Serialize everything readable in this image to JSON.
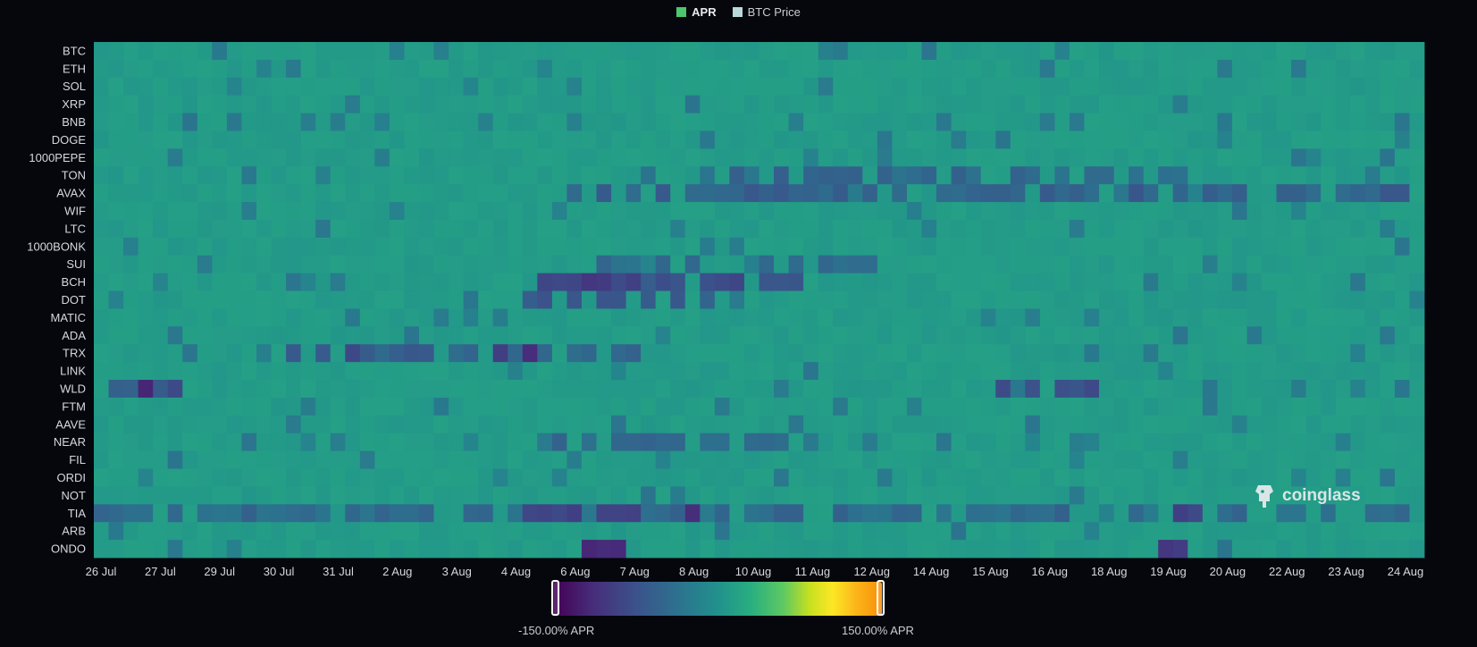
{
  "legend": {
    "apr_label": "APR",
    "btc_label": "BTC Price",
    "apr_color": "#4cc76c",
    "btc_color": "#b8d8da"
  },
  "watermark": {
    "text": "coinglass"
  },
  "scale": {
    "min_label": "-150.00% APR",
    "max_label": "150.00% APR"
  },
  "chart_data": {
    "type": "heatmap",
    "title": "",
    "xlabel": "",
    "ylabel": "",
    "value_range": [
      -150,
      150
    ],
    "value_unit": "% APR",
    "colormap": "viridis-orange",
    "grid": false,
    "y_categories": [
      "BTC",
      "ETH",
      "SOL",
      "XRP",
      "BNB",
      "DOGE",
      "1000PEPE",
      "TON",
      "AVAX",
      "WIF",
      "LTC",
      "1000BONK",
      "SUI",
      "BCH",
      "DOT",
      "MATIC",
      "ADA",
      "TRX",
      "LINK",
      "WLD",
      "FTM",
      "AAVE",
      "NEAR",
      "FIL",
      "ORDI",
      "NOT",
      "TIA",
      "ARB",
      "ONDO"
    ],
    "x_tick_labels": [
      "26 Jul",
      "27 Jul",
      "29 Jul",
      "30 Jul",
      "31 Jul",
      "2 Aug",
      "3 Aug",
      "4 Aug",
      "6 Aug",
      "7 Aug",
      "8 Aug",
      "10 Aug",
      "11 Aug",
      "12 Aug",
      "14 Aug",
      "15 Aug",
      "16 Aug",
      "18 Aug",
      "19 Aug",
      "20 Aug",
      "22 Aug",
      "23 Aug",
      "24 Aug"
    ],
    "x_count": 90,
    "baseline_apr": 10.95,
    "anomalies": [
      {
        "row": "TIA",
        "from": 0,
        "to": 89,
        "apr": -45
      },
      {
        "row": "TIA",
        "from": 29,
        "to": 37,
        "apr": -95
      },
      {
        "row": "TIA",
        "from": 40,
        "to": 41,
        "apr": -110
      },
      {
        "row": "TIA",
        "from": 70,
        "to": 74,
        "apr": -80
      },
      {
        "row": "WLD",
        "from": 0,
        "to": 5,
        "apr": -70
      },
      {
        "row": "WLD",
        "from": 3,
        "to": 3,
        "apr": -115
      },
      {
        "row": "WLD",
        "from": 61,
        "to": 67,
        "apr": -80
      },
      {
        "row": "TRX",
        "from": 13,
        "to": 37,
        "apr": -55
      },
      {
        "row": "TRX",
        "from": 16,
        "to": 17,
        "apr": -100
      },
      {
        "row": "TRX",
        "from": 27,
        "to": 29,
        "apr": -105
      },
      {
        "row": "BCH",
        "from": 30,
        "to": 48,
        "apr": -75
      },
      {
        "row": "BCH",
        "from": 32,
        "to": 36,
        "apr": -95
      },
      {
        "row": "AVAX",
        "from": 30,
        "to": 88,
        "apr": -55
      },
      {
        "row": "ONDO",
        "from": 33,
        "to": 36,
        "apr": -110
      },
      {
        "row": "ONDO",
        "from": 72,
        "to": 73,
        "apr": -105
      },
      {
        "row": "DOT",
        "from": 29,
        "to": 41,
        "apr": -60
      },
      {
        "row": "TON",
        "from": 38,
        "to": 75,
        "apr": -45
      },
      {
        "row": "NEAR",
        "from": 30,
        "to": 50,
        "apr": -40
      },
      {
        "row": "SUI",
        "from": 33,
        "to": 52,
        "apr": -45
      }
    ]
  }
}
